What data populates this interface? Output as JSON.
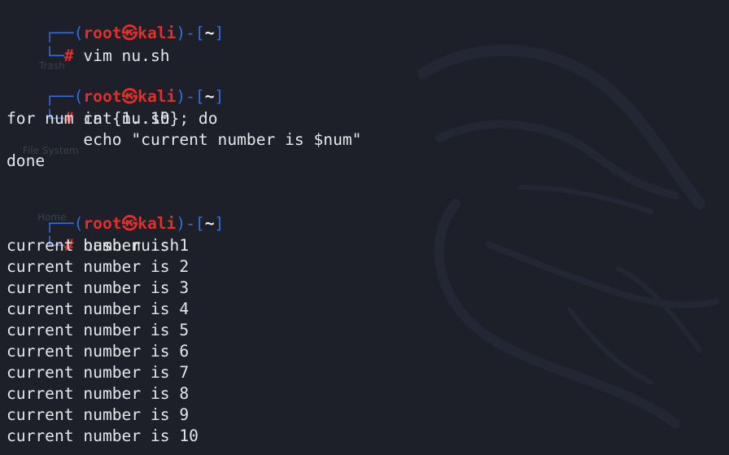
{
  "desktop": {
    "icon_labels": [
      "Trash",
      "File System",
      "Home"
    ]
  },
  "prompt": {
    "open": "┌──(",
    "user": "root",
    "skull": "㉿",
    "host": "kali",
    "mid": ")-[",
    "dir": "~",
    "close": "]",
    "cmd_prefix": "└─",
    "hash": "#"
  },
  "blocks": [
    {
      "command": " vim nu.sh",
      "output": []
    },
    {
      "command": " cat nu.sh",
      "output": [
        "for num in {1..10}; do",
        "        echo \"current number is $num\"",
        "done"
      ]
    },
    {
      "command": " bash nu.sh",
      "output": [
        "current number is 1",
        "current number is 2",
        "current number is 3",
        "current number is 4",
        "current number is 5",
        "current number is 6",
        "current number is 7",
        "current number is 8",
        "current number is 9",
        "current number is 10"
      ]
    }
  ],
  "colors": {
    "background": "#1d2029",
    "prompt_box": "#2f6fe0",
    "prompt_user": "#e0302c",
    "text": "#e4e6ea"
  }
}
